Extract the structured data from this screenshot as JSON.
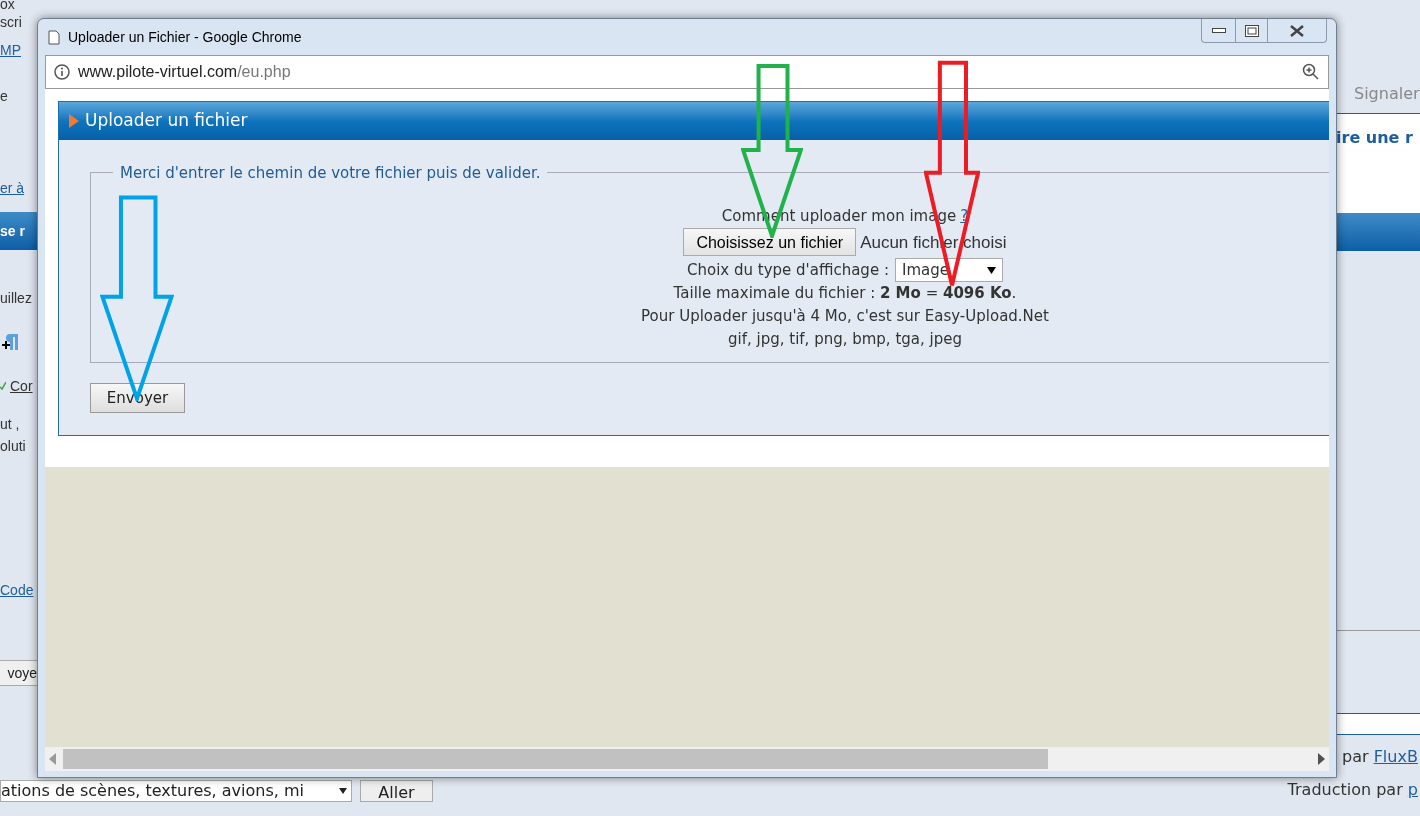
{
  "background_page": {
    "left": [
      {
        "kind": "text",
        "text": "ox"
      },
      {
        "kind": "text",
        "text": "scri"
      },
      {
        "kind": "link",
        "text": "MP"
      },
      {
        "kind": "text",
        "text": "e"
      },
      {
        "kind": "link",
        "text": "er à"
      },
      {
        "kind": "bar",
        "text": "se r"
      },
      {
        "kind": "text",
        "text": "uillez"
      },
      {
        "kind": "icon"
      },
      {
        "kind": "check_link",
        "text": "Cor"
      },
      {
        "kind": "text",
        "text": "ut ,"
      },
      {
        "kind": "text",
        "text": "oluti"
      },
      {
        "kind": "link",
        "text": "Code"
      },
      {
        "kind": "button",
        "text": "voye"
      }
    ],
    "right": {
      "tab": "Signaler",
      "heading": "ire une r"
    },
    "footer": {
      "select_value": "ations de scènes, textures, avions, mi",
      "go_button": "Aller",
      "powered_prefix": "par",
      "powered_link": "FluxB",
      "translation_prefix": "Traduction par",
      "translation_link": "p"
    }
  },
  "popup": {
    "title": "Uploader un Fichier - Google Chrome",
    "url_host": "www.pilote-virtuel.com",
    "url_path": "/eu.php",
    "panel_title": "Uploader un fichier",
    "legend": "Merci d'entrer le chemin de votre fichier puis de valider.",
    "help_text": "Comment uploader mon image",
    "help_link": "?",
    "file_button": "Choisissez un fichier",
    "file_status": "Aucun fichier choisi",
    "display_label": "Choix du type d'affichage :",
    "display_value": "Image",
    "max_size": "Taille maximale du fichier : **2 Mo** = **4096 Ko**.",
    "easy_upload": "Pour Uploader jusqu'à 4 Mo, c'est sur Easy-Upload.Net",
    "formats": "gif, jpg, tif, png, bmp, tga, jpeg",
    "submit": "Envoyer"
  },
  "annotations": [
    {
      "color": "#22b24c"
    },
    {
      "color": "#ed1c24"
    },
    {
      "color": "#00a2e8"
    }
  ]
}
